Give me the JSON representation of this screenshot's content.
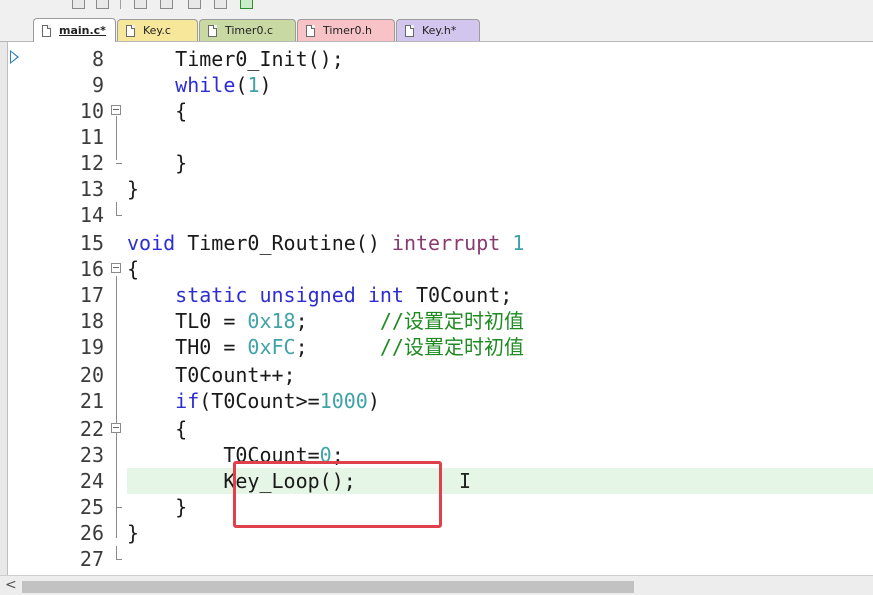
{
  "tabs": [
    {
      "label": "main.c*",
      "active": true,
      "color": "#ffffff"
    },
    {
      "label": "Key.c",
      "active": false,
      "color": "#f6e79b"
    },
    {
      "label": "Timer0.c",
      "active": false,
      "color": "#c9d9a4"
    },
    {
      "label": "Timer0.h",
      "active": false,
      "color": "#f7c3c6"
    },
    {
      "label": "Key.h*",
      "active": false,
      "color": "#d3c6ee"
    }
  ],
  "editor": {
    "lines": [
      {
        "num": "8"
      },
      {
        "num": "9"
      },
      {
        "num": "10"
      },
      {
        "num": "11"
      },
      {
        "num": "12"
      },
      {
        "num": "13"
      },
      {
        "num": "14"
      },
      {
        "num": "15"
      },
      {
        "num": "16"
      },
      {
        "num": "17"
      },
      {
        "num": "18"
      },
      {
        "num": "19"
      },
      {
        "num": "20"
      },
      {
        "num": "21"
      },
      {
        "num": "22"
      },
      {
        "num": "23"
      },
      {
        "num": "24"
      },
      {
        "num": "25"
      },
      {
        "num": "26"
      },
      {
        "num": "27"
      }
    ],
    "code": {
      "l8_a": "    Timer0_Init();",
      "l9_kw": "while",
      "l9_a": "(",
      "l9_num": "1",
      "l9_b": ")",
      "l10": "    {",
      "l12": "    }",
      "l13": "}",
      "l15_kw": "void",
      "l15_a": " Timer0_Routine() ",
      "l15_kw2": "interrupt",
      "l15_num": " 1",
      "l16": "{",
      "l17_kw": "static unsigned int",
      "l17_a": " T0Count;",
      "l18_a": "    TL0 = ",
      "l18_num": "0x18",
      "l18_b": ";      ",
      "l18_cmt": "//设置定时初值",
      "l19_a": "    TH0 = ",
      "l19_num": "0xFC",
      "l19_b": ";      ",
      "l19_cmt": "//设置定时初值",
      "l20": "    T0Count++;",
      "l21_kw": "if",
      "l21_a": "(T0Count>=",
      "l21_num": "1000",
      "l21_b": ")",
      "l22": "    {",
      "l23_a": "        T0Count=",
      "l23_num": "0",
      "l23_b": ";",
      "l24": "        Key_Loop();",
      "l25": "    }",
      "l26": "}"
    },
    "caret_glyph": "I",
    "highlight_color": "#e6f6e6",
    "annotation_color": "#e0404a"
  },
  "scrollbar": {
    "left_arrow": "<"
  }
}
